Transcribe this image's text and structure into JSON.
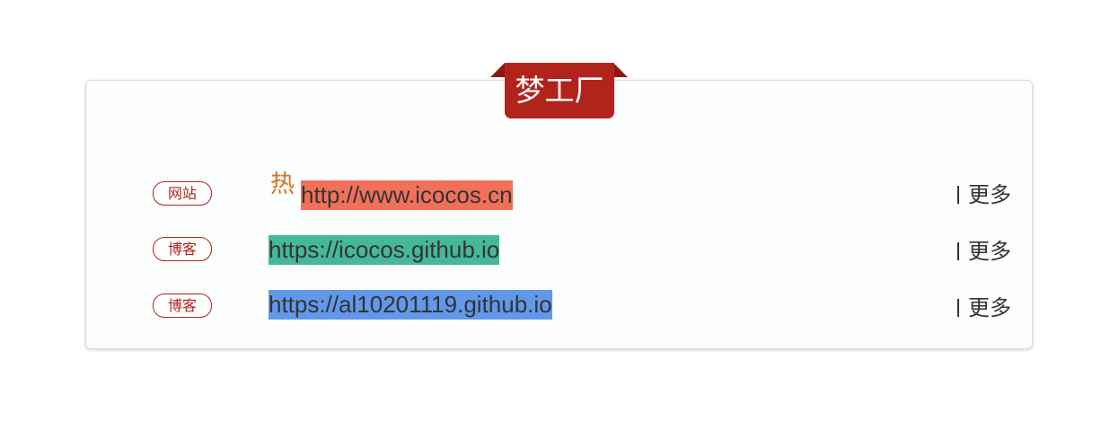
{
  "panel": {
    "title": "梦工厂"
  },
  "rows": [
    {
      "tag": "网站",
      "hot_badge": "热",
      "url": "http://www.icocos.cn",
      "more": "更多",
      "highlight_color": "#f1705a"
    },
    {
      "tag": "博客",
      "url": "https://icocos.github.io",
      "more": "更多",
      "highlight_color": "#45b89a"
    },
    {
      "tag": "博客",
      "url": "https://al10201119.github.io",
      "more": "更多",
      "highlight_color": "#6198ea"
    }
  ],
  "colors": {
    "accent": "#b0241c",
    "text": "#333333"
  },
  "icons": {
    "hot_badge": "hot-icon"
  }
}
